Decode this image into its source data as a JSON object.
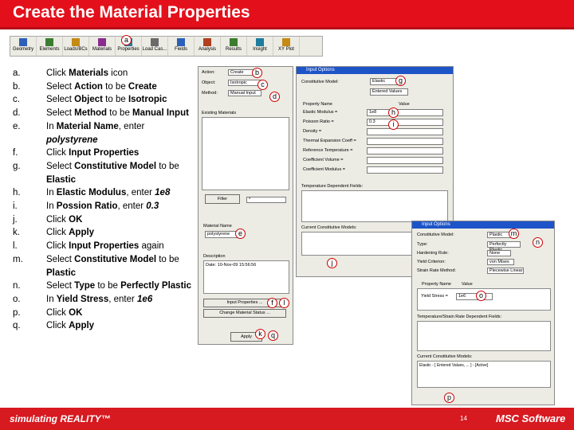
{
  "title": "Create the Material Properties",
  "toolbar": {
    "items": [
      "Geometry",
      "Elements",
      "Loads/BCs",
      "Materials",
      "Properties",
      "Load Cas...",
      "Fields",
      "Analysis",
      "Results",
      "Insight",
      "XY Plot"
    ]
  },
  "steps": [
    {
      "letter": "a.",
      "parts": [
        [
          "Click ",
          "n"
        ],
        [
          "Materials",
          "b"
        ],
        [
          " icon",
          "n"
        ]
      ]
    },
    {
      "letter": "b.",
      "parts": [
        [
          "Select ",
          "n"
        ],
        [
          "Action",
          "b"
        ],
        [
          " to be ",
          "n"
        ],
        [
          "Create",
          "b"
        ]
      ]
    },
    {
      "letter": "c.",
      "parts": [
        [
          "Select ",
          "n"
        ],
        [
          "Object",
          "b"
        ],
        [
          " to be ",
          "n"
        ],
        [
          "Isotropic",
          "b"
        ]
      ]
    },
    {
      "letter": "d.",
      "parts": [
        [
          "Select ",
          "n"
        ],
        [
          "Method",
          "b"
        ],
        [
          " to be ",
          "n"
        ],
        [
          "Manual Input",
          "b"
        ]
      ]
    },
    {
      "letter": "e.",
      "parts": [
        [
          "In ",
          "n"
        ],
        [
          "Material Name",
          "b"
        ],
        [
          ", enter ",
          "n"
        ],
        [
          "polystyrene",
          "bi"
        ]
      ]
    },
    {
      "letter": "f.",
      "parts": [
        [
          "Click ",
          "n"
        ],
        [
          "Input Properties",
          "b"
        ]
      ]
    },
    {
      "letter": "g.",
      "parts": [
        [
          "Select ",
          "n"
        ],
        [
          "Constitutive Model",
          "b"
        ],
        [
          " to be ",
          "n"
        ],
        [
          "Elastic",
          "b"
        ]
      ]
    },
    {
      "letter": "h.",
      "parts": [
        [
          "In ",
          "n"
        ],
        [
          "Elastic Modulus",
          "b"
        ],
        [
          ", enter ",
          "n"
        ],
        [
          "1e8",
          "bi"
        ]
      ]
    },
    {
      "letter": "i.",
      "parts": [
        [
          "In ",
          "n"
        ],
        [
          "Possion Ratio",
          "b"
        ],
        [
          ", enter ",
          "n"
        ],
        [
          "0.3",
          "bi"
        ]
      ]
    },
    {
      "letter": "j.",
      "parts": [
        [
          "Click ",
          "n"
        ],
        [
          "OK",
          "b"
        ]
      ]
    },
    {
      "letter": "k.",
      "parts": [
        [
          "Click ",
          "n"
        ],
        [
          "Apply",
          "b"
        ]
      ]
    },
    {
      "letter": "l.",
      "parts": [
        [
          "Click ",
          "n"
        ],
        [
          "Input Properties",
          "b"
        ],
        [
          " again",
          "n"
        ]
      ]
    },
    {
      "letter": "m.",
      "parts": [
        [
          "Select ",
          "n"
        ],
        [
          "Constitutive Model",
          "b"
        ],
        [
          " to be ",
          "n"
        ],
        [
          "Plastic",
          "b"
        ]
      ]
    },
    {
      "letter": "n.",
      "parts": [
        [
          "Select ",
          "n"
        ],
        [
          "Type",
          "b"
        ],
        [
          " to be ",
          "n"
        ],
        [
          "Perfectly Plastic",
          "b"
        ]
      ]
    },
    {
      "letter": "o.",
      "parts": [
        [
          "In ",
          "n"
        ],
        [
          "Yield Stress",
          "b"
        ],
        [
          ", enter ",
          "n"
        ],
        [
          "1e6",
          "bi"
        ]
      ]
    },
    {
      "letter": "p.",
      "parts": [
        [
          "Click ",
          "n"
        ],
        [
          "OK",
          "b"
        ]
      ]
    },
    {
      "letter": "q.",
      "parts": [
        [
          "Click ",
          "n"
        ],
        [
          "Apply",
          "b"
        ]
      ]
    }
  ],
  "callouts": {
    "a": "a",
    "b": "b",
    "c": "c",
    "d": "d",
    "e": "e",
    "f": "f",
    "g": "g",
    "h": "h",
    "i": "i",
    "j": "j",
    "k": "k",
    "l": "l",
    "m": "m",
    "n": "n",
    "o": "o",
    "p": "p",
    "q": "q"
  },
  "materials_panel": {
    "action_label": "Action:",
    "action_value": "Create",
    "object_label": "Object:",
    "object_value": "Isotropic",
    "method_label": "Method:",
    "method_value": "Manual Input",
    "existing_label": "Existing Materials",
    "filter_button": "Filter",
    "filter_value": "*",
    "name_label": "Material Name",
    "name_value": "polystyrene",
    "description_label": "Description",
    "description_value": "Date: 10-Nov-09 15:56:56",
    "input_properties_button": "Input Properties ...",
    "change_status_button": "Change Material Status ...",
    "apply_button": "Apply"
  },
  "input_options_1": {
    "title": "Input Options",
    "model_label": "Constitutive Model:",
    "model_value": "Elastic",
    "sub_value": "Entered Values",
    "col1": "Property Name",
    "col2": "Value",
    "rows": [
      "Elastic Modulus =",
      "Poisson Ratio =",
      "Density =",
      "Thermal Expansion Coeff =",
      "Reference Temperature =",
      "Coefficient Volume =",
      "Coefficient Modulus ="
    ],
    "row_values": [
      "1e8",
      "0.3",
      "",
      "",
      "",
      "",
      ""
    ],
    "dependent_label": "Temperature Dependent Fields:",
    "current_models_label": "Current Constitutive Models:"
  },
  "input_options_2": {
    "title": "Input Options",
    "model_label": "Constitutive Model:",
    "model_value": "Plastic",
    "type_label": "Type:",
    "type_value": "Perfectly Plastic",
    "hardening_label": "Hardening Rule:",
    "hardening_value": "None",
    "criterion_label": "Yield Criterion:",
    "criterion_value": "von Mises",
    "strain_label": "Strain Rate Method:",
    "strain_value": "Piecewise Linear",
    "col1": "Property Name",
    "col2": "Value",
    "row_label": "Yield Stress =",
    "row_value": "1e6",
    "dependent_label": "Temperature/Strain Rate Dependent Fields:",
    "current_label": "Current Constitutive Models:",
    "current_value": "Elastic - [ Entered Values, ... ] - [Active]"
  },
  "footer": {
    "tagline": "simulating REALITY™",
    "page": "14",
    "logo": "MSC Software"
  },
  "colors": {
    "brand_red": "#e3101b",
    "callout_ring": "#cc0000",
    "window_title": "#1d54c8"
  }
}
